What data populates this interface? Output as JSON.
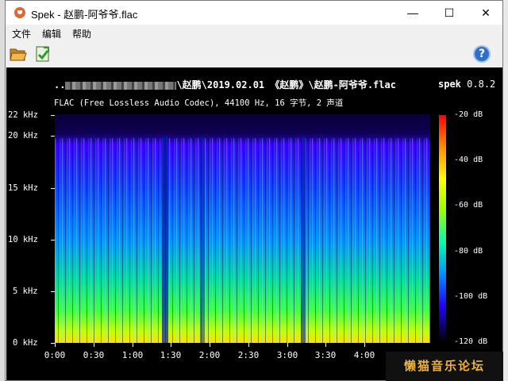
{
  "window": {
    "title": "Spek - 赵鹏-阿爷爷.flac",
    "minimize": "—",
    "maximize": "☐",
    "close": "✕"
  },
  "menu": [
    "文件",
    "编辑",
    "帮助"
  ],
  "toolbar": {
    "open_icon": "folder-open-icon",
    "save_icon": "save-export-icon",
    "help_icon": "help-icon",
    "help_glyph": "?"
  },
  "header": {
    "file_path_prefix": "..",
    "file_path": "\\赵鹏\\2019.02.01 《赵鹏》\\赵鹏-阿爷爷.flac",
    "app_name": "spek",
    "app_version": "0.8.2",
    "file_info": "FLAC (Free Lossless Audio Codec), 44100 Hz, 16 字节, 2 声道"
  },
  "axes": {
    "y_labels": [
      "22 kHz",
      "20 kHz",
      "15 kHz",
      "10 kHz",
      "5 kHz",
      "0 kHz"
    ],
    "x_labels": [
      "0:00",
      "0:30",
      "1:00",
      "1:30",
      "2:00",
      "2:30",
      "3:00",
      "3:30",
      "4:00"
    ],
    "legend_labels": [
      "-20 dB",
      "-40 dB",
      "-60 dB",
      "-80 dB",
      "-100 dB",
      "-120 dB"
    ]
  },
  "colors": {
    "accent": "#2f6fc5",
    "watermark_text": "#f0b23c",
    "spectrogram_low": "#00ff60",
    "spectrogram_high": "#2a00ff"
  },
  "watermark": "懒猫音乐论坛"
}
